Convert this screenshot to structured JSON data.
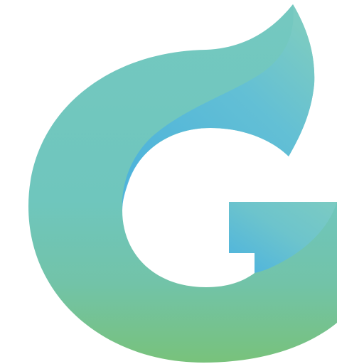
{
  "logo": {
    "icon": "letter-g-leaf-logo",
    "colors": {
      "teal": "#6fc6bd",
      "teal_light": "#7ccbc2",
      "blue": "#4db3dc",
      "green": "#78c27b",
      "background": "#ffffff"
    }
  }
}
